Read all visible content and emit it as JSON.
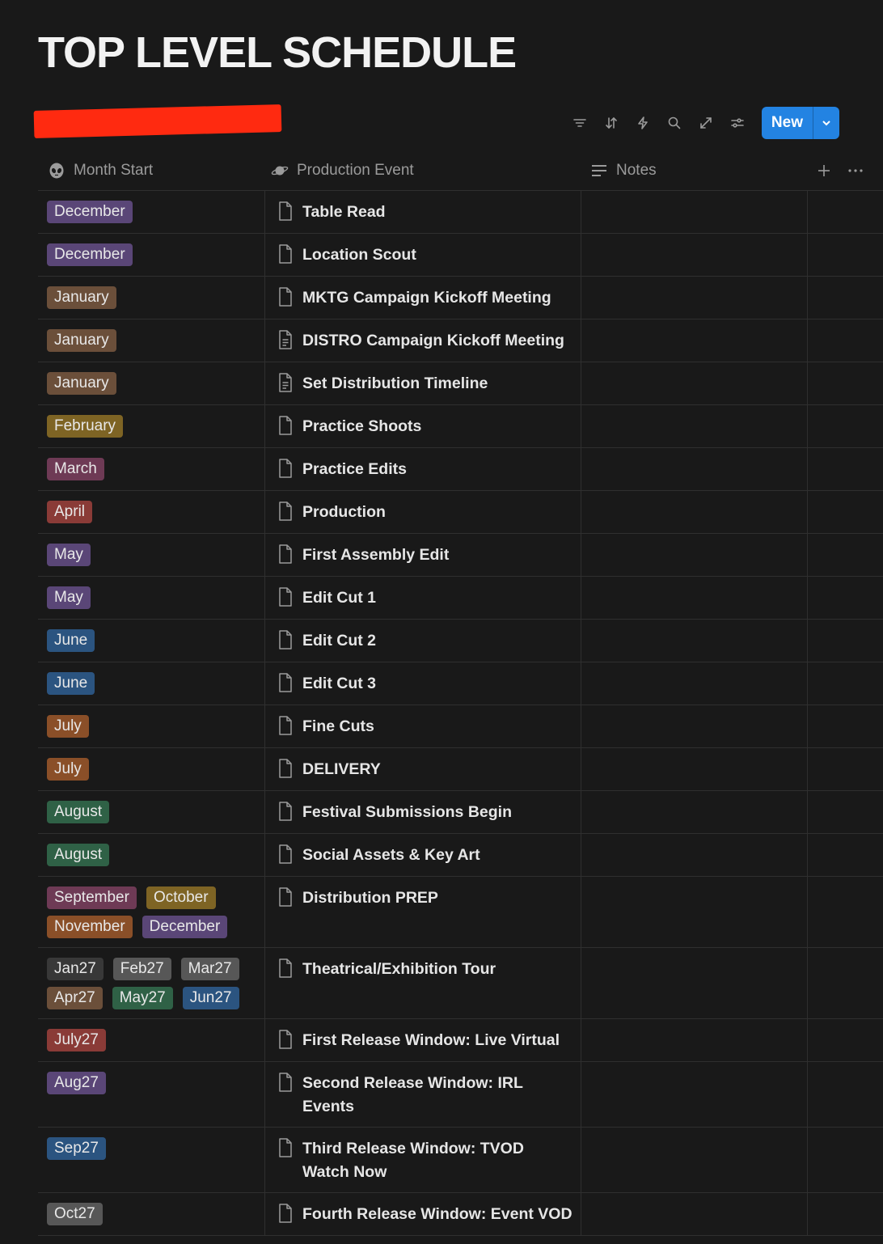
{
  "page": {
    "title": "TOP LEVEL SCHEDULE",
    "view_name": ""
  },
  "toolbar": {
    "new_label": "New"
  },
  "columns": {
    "month": "Month Start",
    "event": "Production Event",
    "notes": "Notes"
  },
  "tag_colors": {
    "purple": "#5a4677",
    "brown": "#6b4f3a",
    "gold": "#7e6424",
    "pink": "#6e3a55",
    "red": "#8a3b37",
    "blue": "#2b5480",
    "orange": "#8a4f28",
    "green": "#2f6146",
    "gray": "#575757",
    "dark": "#383838"
  },
  "rows": [
    {
      "tags": [
        {
          "label": "December",
          "color": "purple"
        }
      ],
      "event": "Table Read",
      "icon": "page-icon",
      "height": 53
    },
    {
      "tags": [
        {
          "label": "December",
          "color": "purple"
        }
      ],
      "event": "Location Scout",
      "icon": "page-icon",
      "height": 53
    },
    {
      "tags": [
        {
          "label": "January",
          "color": "brown"
        }
      ],
      "event": "MKTG Campaign Kickoff Meeting",
      "icon": "page-icon",
      "height": 53
    },
    {
      "tags": [
        {
          "label": "January",
          "color": "brown"
        }
      ],
      "event": "DISTRO Campaign Kickoff Meeting",
      "icon": "page-text-icon",
      "height": 53
    },
    {
      "tags": [
        {
          "label": "January",
          "color": "brown"
        }
      ],
      "event": "Set Distribution Timeline",
      "icon": "page-text-icon",
      "height": 53
    },
    {
      "tags": [
        {
          "label": "February",
          "color": "gold"
        }
      ],
      "event": "Practice Shoots",
      "icon": "page-icon",
      "height": 53
    },
    {
      "tags": [
        {
          "label": "March",
          "color": "pink"
        }
      ],
      "event": "Practice Edits",
      "icon": "page-icon",
      "height": 53
    },
    {
      "tags": [
        {
          "label": "April",
          "color": "red"
        }
      ],
      "event": "Production",
      "icon": "page-icon",
      "height": 53
    },
    {
      "tags": [
        {
          "label": "May",
          "color": "purple"
        }
      ],
      "event": "First Assembly Edit",
      "icon": "page-icon",
      "height": 53
    },
    {
      "tags": [
        {
          "label": "May",
          "color": "purple"
        }
      ],
      "event": "Edit Cut 1",
      "icon": "page-icon",
      "height": 53
    },
    {
      "tags": [
        {
          "label": "June",
          "color": "blue"
        }
      ],
      "event": "Edit Cut 2",
      "icon": "page-icon",
      "height": 53
    },
    {
      "tags": [
        {
          "label": "June",
          "color": "blue"
        }
      ],
      "event": "Edit Cut 3",
      "icon": "page-icon",
      "height": 53
    },
    {
      "tags": [
        {
          "label": "July",
          "color": "orange"
        }
      ],
      "event": "Fine Cuts",
      "icon": "page-icon",
      "height": 53
    },
    {
      "tags": [
        {
          "label": "July",
          "color": "orange"
        }
      ],
      "event": "DELIVERY",
      "icon": "page-icon",
      "height": 53
    },
    {
      "tags": [
        {
          "label": "August",
          "color": "green"
        }
      ],
      "event": "Festival Submissions Begin",
      "icon": "page-icon",
      "height": 53
    },
    {
      "tags": [
        {
          "label": "August",
          "color": "green"
        }
      ],
      "event": "Social Assets & Key Art",
      "icon": "page-icon",
      "height": 53
    },
    {
      "tags": [
        {
          "label": "September",
          "color": "pink"
        },
        {
          "label": "October",
          "color": "gold"
        },
        {
          "label": "November",
          "color": "orange"
        },
        {
          "label": "December",
          "color": "purple"
        }
      ],
      "event": "Distribution PREP",
      "icon": "page-icon",
      "height": 88
    },
    {
      "tags": [
        {
          "label": "Jan27",
          "color": "dark"
        },
        {
          "label": "Feb27",
          "color": "gray"
        },
        {
          "label": "Mar27",
          "color": "gray"
        },
        {
          "label": "Apr27",
          "color": "brown"
        },
        {
          "label": "May27",
          "color": "green"
        },
        {
          "label": "Jun27",
          "color": "blue"
        }
      ],
      "event": "Theatrical/Exhibition Tour",
      "icon": "page-icon",
      "height": 88
    },
    {
      "tags": [
        {
          "label": "July27",
          "color": "red"
        }
      ],
      "event": "First Release Window: Live Virtual",
      "icon": "page-icon",
      "height": 53
    },
    {
      "tags": [
        {
          "label": "Aug27",
          "color": "purple"
        }
      ],
      "event": "Second Release Window: IRL Events",
      "icon": "page-icon",
      "height": 81
    },
    {
      "tags": [
        {
          "label": "Sep27",
          "color": "blue"
        }
      ],
      "event": "Third Release Window: TVOD Watch Now",
      "icon": "page-icon",
      "height": 81
    },
    {
      "tags": [
        {
          "label": "Oct27",
          "color": "gray"
        }
      ],
      "event": "Fourth Release Window: Event VOD",
      "icon": "page-icon",
      "height": 53
    }
  ]
}
